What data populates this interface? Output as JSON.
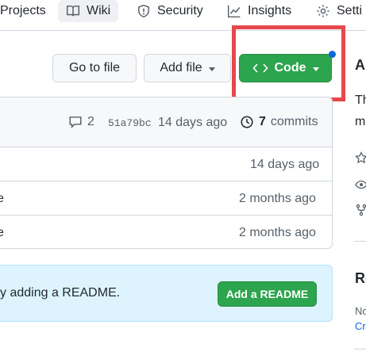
{
  "nav": {
    "projects": "Projects",
    "wiki": "Wiki",
    "security": "Security",
    "insights": "Insights",
    "settings": "Setti"
  },
  "actions": {
    "go_to_file": "Go to file",
    "add_file": "Add file",
    "code": "Code"
  },
  "commit_bar": {
    "comments": "2",
    "sha": "51a79bc",
    "time": "14 days ago",
    "commits_count": "7",
    "commits_label": "commits"
  },
  "files": [
    {
      "name": "",
      "time": "14 days ago"
    },
    {
      "name": "e",
      "time": "2 months ago"
    },
    {
      "name": "e",
      "time": "2 months ago"
    }
  ],
  "readme": {
    "text": "y adding a README.",
    "button": "Add a README"
  },
  "sidebar": {
    "about_initial": "A",
    "desc_initial_1": "Th",
    "desc_initial_2": "m",
    "releases_initial": "Re",
    "no_initial": "No",
    "create_initial": "Cr"
  },
  "colors": {
    "accent_green": "#2da44e",
    "highlight_red": "#e5484d",
    "notification_blue": "#0969da",
    "readme_bg": "#ddf4ff"
  }
}
